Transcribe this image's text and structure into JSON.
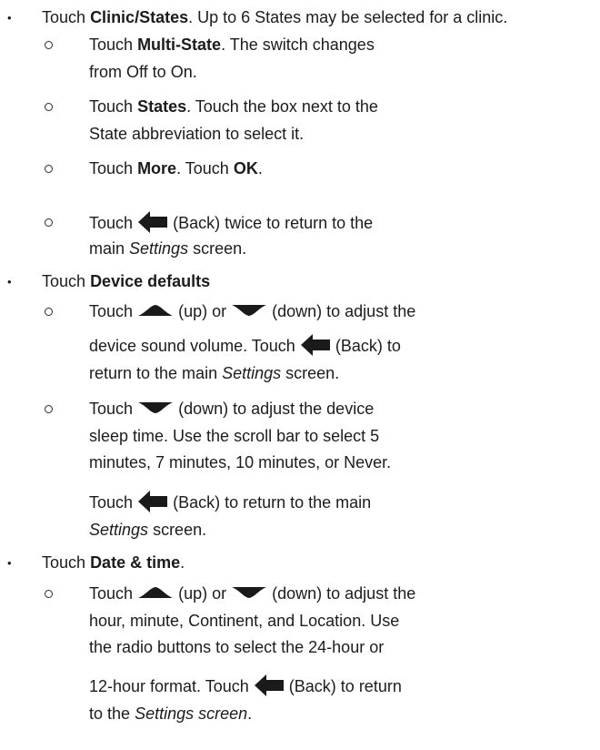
{
  "sections": [
    {
      "lead": "Touch",
      "label": "Clinic/States",
      "tail": ". Up to 6 States may be selected for a clinic.",
      "items": [
        {
          "a": "Touch",
          "bold": "Multi-State",
          "b": ". The switch changes",
          "line2": "from Off to On."
        },
        {
          "a": "Touch",
          "bold": "States",
          "b": ". Touch the box next to the",
          "line2": "State abbreviation to select it."
        },
        {
          "a": "Touch",
          "bold": "More",
          "b": ". Touch",
          "bold2": "OK",
          "c": "."
        },
        {
          "a": "Touch",
          "icon": "back-arrow",
          "b": "(Back) twice to return to the",
          "line2a": "main",
          "line2i": "Settings",
          "line2b": "screen."
        }
      ]
    },
    {
      "lead": "Touch",
      "label": "Device defaults",
      "items": [
        {
          "a": "Touch",
          "icon1": "up-arrow",
          "b": "(up) or",
          "icon2": "down-arrow",
          "c": "(down) to adjust the",
          "line2a": "device sound volume. Touch",
          "icon3": "back-arrow",
          "line2b": "(Back) to",
          "line3a": "return to the main",
          "line3i": "Settings",
          "line3b": "screen."
        },
        {
          "a": "Touch",
          "icon1": "down-arrow",
          "b": "(down) to adjust the device",
          "line2": "sleep time. Use the scroll bar to select 5",
          "line3": "minutes, 7 minutes, 10 minutes, or Never.",
          "line4a": "Touch",
          "icon2": "back-arrow",
          "line4b": "(Back) to return to the main",
          "line5i": "Settings",
          "line5b": "screen."
        }
      ]
    },
    {
      "lead": "Touch",
      "label": "Date & time",
      "tail": ".",
      "items": [
        {
          "a": "Touch",
          "icon1": "up-arrow",
          "b": "(up) or",
          "icon2": "down-arrow",
          "c": "(down) to adjust the",
          "line2": "hour, minute, Continent, and Location. Use",
          "line3": "the radio buttons to select the 24-hour or",
          "line4a": "12-hour format. Touch",
          "icon3": "back-arrow",
          "line4b": "(Back) to return",
          "line5a": "to the",
          "line5i": "Settings screen",
          "line5b": "."
        }
      ]
    }
  ]
}
